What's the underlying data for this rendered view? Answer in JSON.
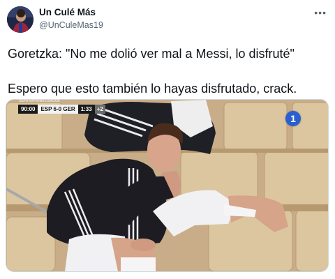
{
  "tweet": {
    "display_name": "Un Culé Más",
    "handle": "@UnCuleMas19",
    "more_icon": "more-dots-icon",
    "text_line_1": "Goretzka: \"No me dolió ver mal a Messi, lo disfruté\"",
    "text_line_2": "Espero que esto también lo hayas disfrutado, crack."
  },
  "media": {
    "league": "UEFA NATIONS LEAGUE",
    "time": "90:00",
    "score": "ESP 6-0 GER",
    "clock": "1:33",
    "added_time": "+2",
    "channel_logo": "1"
  },
  "colors": {
    "text": "#0f1419",
    "secondary": "#536471",
    "seat_yellow": "#d9c39a",
    "jacket_black": "#1c1c22"
  }
}
